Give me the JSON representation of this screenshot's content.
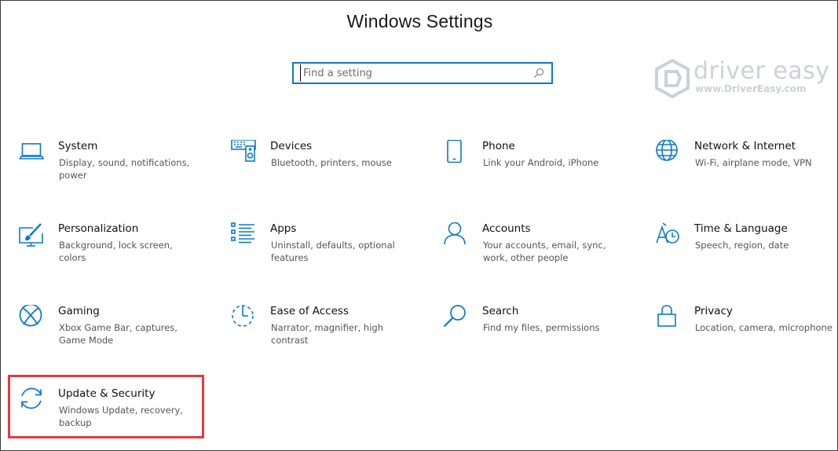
{
  "window": {
    "title": "Windows Settings"
  },
  "search": {
    "placeholder": "Find a setting"
  },
  "watermark": {
    "brand": "driver easy",
    "url": "www.DriverEasy.com"
  },
  "colors": {
    "accent": "#0b78d0",
    "highlight": "#e8383f"
  },
  "tiles": [
    {
      "name": "System",
      "desc": "Display, sound, notifications, power",
      "icon": "laptop-icon"
    },
    {
      "name": "Devices",
      "desc": "Bluetooth, printers, mouse",
      "icon": "devices-icon"
    },
    {
      "name": "Phone",
      "desc": "Link your Android, iPhone",
      "icon": "phone-icon"
    },
    {
      "name": "Network & Internet",
      "desc": "Wi-Fi, airplane mode, VPN",
      "icon": "globe-icon"
    },
    {
      "name": "Personalization",
      "desc": "Background, lock screen, colors",
      "icon": "paintbrush-icon"
    },
    {
      "name": "Apps",
      "desc": "Uninstall, defaults, optional features",
      "icon": "apps-list-icon"
    },
    {
      "name": "Accounts",
      "desc": "Your accounts, email, sync, work, other people",
      "icon": "person-icon"
    },
    {
      "name": "Time & Language",
      "desc": "Speech, region, date",
      "icon": "time-language-icon"
    },
    {
      "name": "Gaming",
      "desc": "Xbox Game Bar, captures, Game Mode",
      "icon": "xbox-icon"
    },
    {
      "name": "Ease of Access",
      "desc": "Narrator, magnifier, high contrast",
      "icon": "ease-of-access-icon"
    },
    {
      "name": "Search",
      "desc": "Find my files, permissions",
      "icon": "search-icon"
    },
    {
      "name": "Privacy",
      "desc": "Location, camera, microphone",
      "icon": "lock-icon"
    },
    {
      "name": "Update & Security",
      "desc": "Windows Update, recovery, backup",
      "icon": "sync-icon"
    }
  ]
}
